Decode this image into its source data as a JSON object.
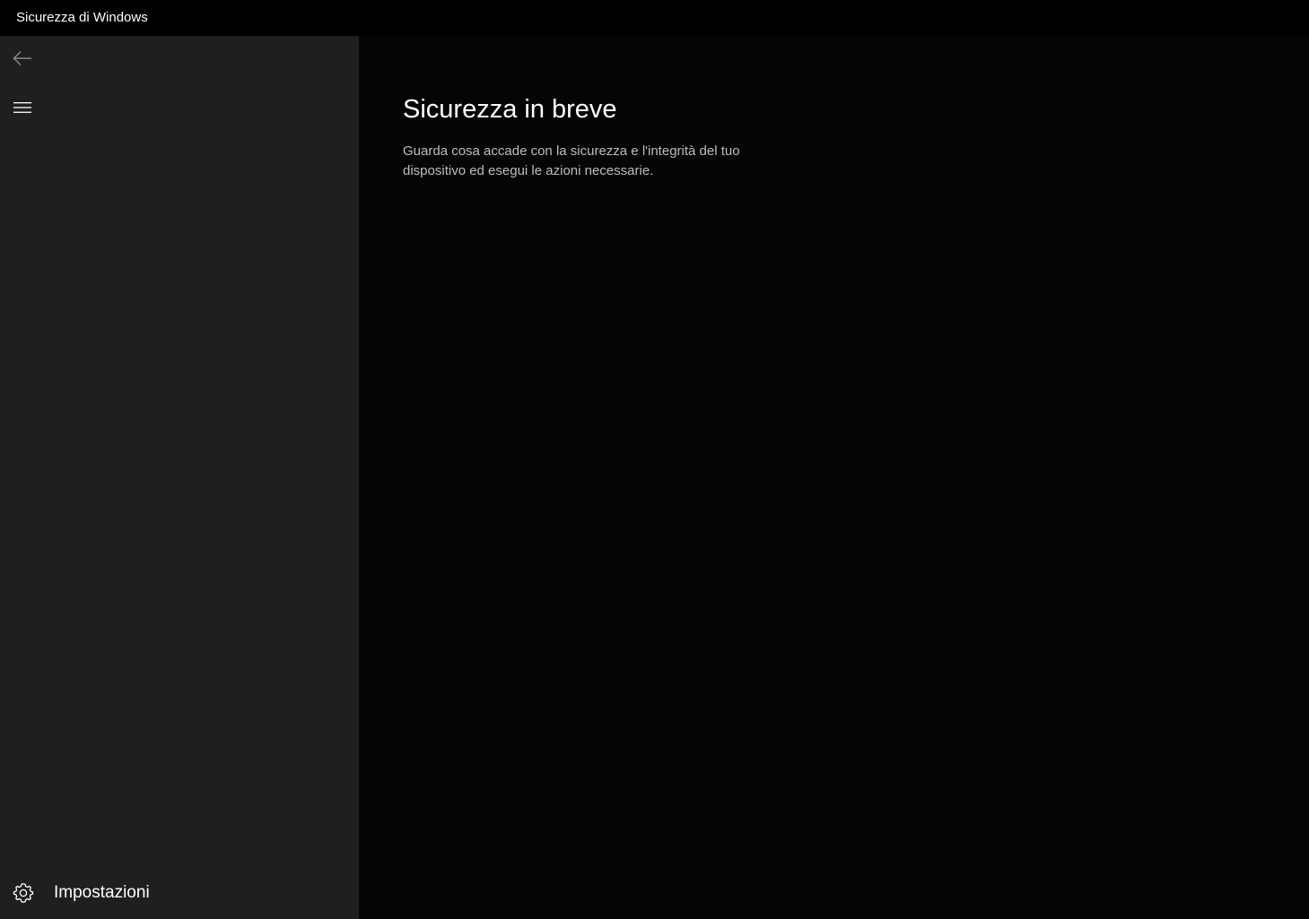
{
  "window": {
    "title": "Sicurezza di Windows"
  },
  "sidebar": {
    "back_icon": "arrow-left-icon",
    "menu_icon": "hamburger-menu-icon",
    "settings": {
      "label": "Impostazioni",
      "icon": "gear-icon"
    }
  },
  "main": {
    "title": "Sicurezza in breve",
    "description": "Guarda cosa accade con la sicurezza e l'integrità del tuo dispositivo ed esegui le azioni necessarie."
  },
  "colors": {
    "titlebar_bg": "#000000",
    "sidebar_bg": "#1f1f1f",
    "main_bg": "#050505",
    "text_primary": "#ffffff",
    "text_secondary": "#bdbdbd"
  }
}
